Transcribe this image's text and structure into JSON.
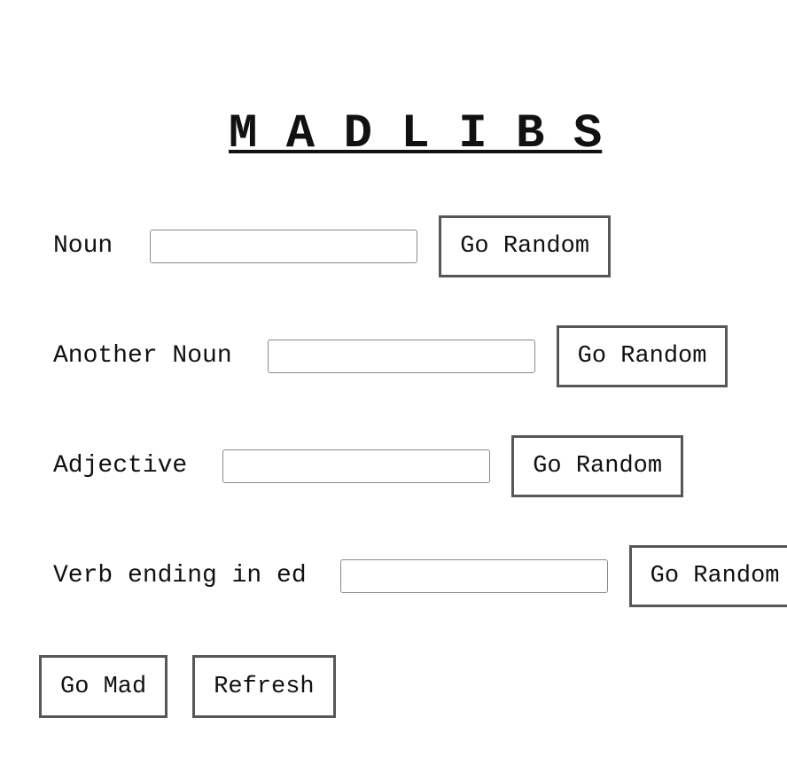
{
  "header": {
    "title": "M A D L I B S"
  },
  "form": {
    "fields": [
      {
        "label": "Noun",
        "value": "",
        "placeholder": "",
        "button_label": "Go Random"
      },
      {
        "label": "Another Noun",
        "value": "",
        "placeholder": "",
        "button_label": "Go Random"
      },
      {
        "label": "Adjective",
        "value": "",
        "placeholder": "",
        "button_label": "Go Random"
      },
      {
        "label": "Verb ending in ed",
        "value": "",
        "placeholder": "",
        "button_label": "Go Random"
      }
    ]
  },
  "actions": {
    "go_mad_label": "Go Mad",
    "refresh_label": "Refresh"
  }
}
